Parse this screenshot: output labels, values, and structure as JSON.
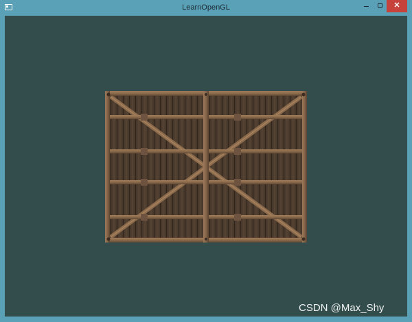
{
  "window": {
    "title": "LearnOpenGL",
    "controls": {
      "minimize_icon": "minimize-icon",
      "maximize_icon": "maximize-icon",
      "close_glyph": "✕"
    }
  },
  "scene": {
    "clear_color": "#334d4d",
    "object": "wooden-crate-texture"
  },
  "watermark": "CSDN @Max_Shy",
  "colors": {
    "frame": "#5aa1b8",
    "close_button": "#c7423a"
  }
}
